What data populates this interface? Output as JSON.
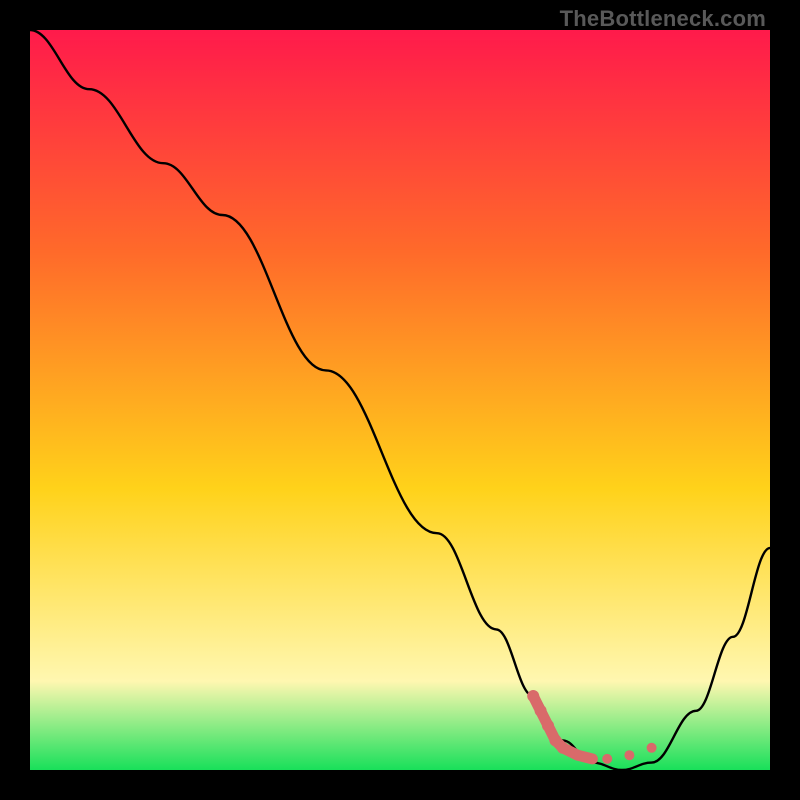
{
  "watermark": "TheBottleneck.com",
  "gradient_colors": {
    "top": "#ff1a4b",
    "upper": "#ff6a2a",
    "mid": "#ffd21a",
    "low": "#fff7b0",
    "bottom": "#18e05a"
  },
  "chart_data": {
    "type": "line",
    "title": "",
    "xlabel": "",
    "ylabel": "",
    "xlim": [
      0,
      100
    ],
    "ylim": [
      0,
      100
    ],
    "series": [
      {
        "name": "bottleneck-curve",
        "x": [
          0,
          8,
          18,
          26,
          40,
          55,
          63,
          68,
          72,
          76,
          80,
          84,
          90,
          95,
          100
        ],
        "y": [
          100,
          92,
          82,
          75,
          54,
          32,
          19,
          10,
          4,
          1,
          0,
          1,
          8,
          18,
          30
        ]
      }
    ],
    "markers": {
      "name": "optimal-range",
      "color": "#d96a6a",
      "points": [
        {
          "x": 68,
          "y": 10
        },
        {
          "x": 69,
          "y": 8
        },
        {
          "x": 70,
          "y": 6
        },
        {
          "x": 71,
          "y": 4
        },
        {
          "x": 72,
          "y": 3
        },
        {
          "x": 74,
          "y": 2
        },
        {
          "x": 76,
          "y": 1.5
        },
        {
          "x": 78,
          "y": 1.5
        },
        {
          "x": 81,
          "y": 2
        },
        {
          "x": 84,
          "y": 3
        }
      ]
    }
  }
}
